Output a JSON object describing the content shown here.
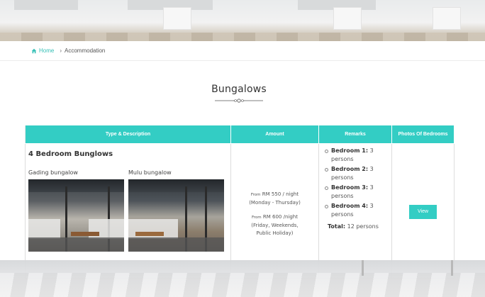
{
  "breadcrumb": {
    "home": "Home",
    "current": "Accommodation"
  },
  "page_title": "Bungalows",
  "table": {
    "headers": [
      "Type & Description",
      "Amount",
      "Remarks",
      "Photos Of Bedrooms"
    ],
    "row": {
      "type_title": "4 Bedroom Bunglows",
      "photos": [
        {
          "caption": "Gading bungalow"
        },
        {
          "caption": "Mulu bungalow"
        }
      ],
      "amount": [
        {
          "from": "From",
          "price": "RM 550 / night",
          "when": "(Monday - Thursday)"
        },
        {
          "from": "From",
          "price": "RM 600 /night",
          "when": "(Friday, Weekends, Public Holiday)"
        }
      ],
      "remarks": [
        {
          "label": "Bedroom 1:",
          "value": "3 persons"
        },
        {
          "label": "Bedroom 2:",
          "value": "3 persons"
        },
        {
          "label": "Bedroom 3:",
          "value": "3 persons"
        },
        {
          "label": "Bedroom 4:",
          "value": "3 persons"
        }
      ],
      "total_label": "Total:",
      "total_value": "12 persons",
      "view_label": "View"
    }
  },
  "colors": {
    "accent": "#33cdc4",
    "link": "#33bfb5"
  },
  "icons": {
    "breadcrumb_home": "home-icon"
  }
}
